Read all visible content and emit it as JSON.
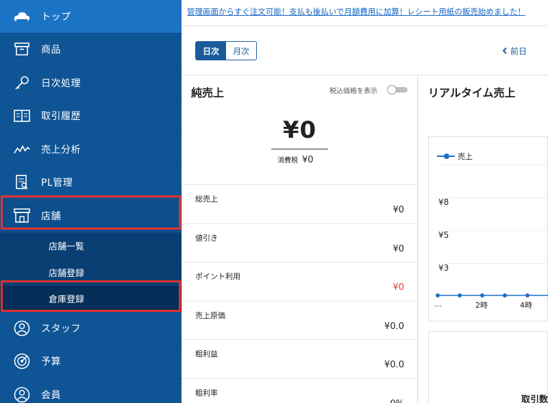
{
  "sidebar": {
    "items": [
      {
        "label": "トップ",
        "icon": "cloud-icon"
      },
      {
        "label": "商品",
        "icon": "box-icon"
      },
      {
        "label": "日次処理",
        "icon": "key-icon"
      },
      {
        "label": "取引履歴",
        "icon": "book-icon"
      },
      {
        "label": "売上分析",
        "icon": "trend-icon"
      },
      {
        "label": "PL管理",
        "icon": "report-icon"
      },
      {
        "label": "店舗",
        "icon": "store-icon"
      }
    ],
    "sub_items": [
      "店舗一覧",
      "店舗登録",
      "倉庫登録"
    ],
    "items_after": [
      {
        "label": "スタッフ",
        "icon": "person-icon"
      },
      {
        "label": "予算",
        "icon": "target-icon"
      },
      {
        "label": "会員",
        "icon": "member-icon"
      }
    ]
  },
  "banner": {
    "text": "管理画面からすぐ注文可能！支払も後払いで月額費用に加算！レシート用紙の販売始めました！"
  },
  "toolbar": {
    "daily": "日次",
    "monthly": "月次",
    "prev": "前日"
  },
  "sales": {
    "title": "純売上",
    "tax_toggle_label": "税込価格を表示",
    "total": "¥0",
    "tax_label": "消費税",
    "tax_value": "¥0",
    "rows": [
      {
        "label": "総売上",
        "value": "¥0"
      },
      {
        "label": "値引き",
        "value": "¥0"
      },
      {
        "label": "ポイント利用",
        "value": "¥0"
      },
      {
        "label": "売上原価",
        "value": "¥0.0"
      },
      {
        "label": "粗利益",
        "value": "¥0.0"
      },
      {
        "label": "粗利率",
        "value": "0%"
      }
    ]
  },
  "realtime": {
    "title": "リアルタイム売上",
    "legend": "売上",
    "y_ticks": [
      "¥8",
      "¥5",
      "¥3"
    ],
    "x_ticks": [
      "...",
      "2時",
      "4時"
    ],
    "second_card_title": "取引数"
  },
  "colors": {
    "sidebar": "#0f5596",
    "highlight": "#e4312b",
    "accent": "#1a5b9c",
    "negative": "#e53935"
  }
}
